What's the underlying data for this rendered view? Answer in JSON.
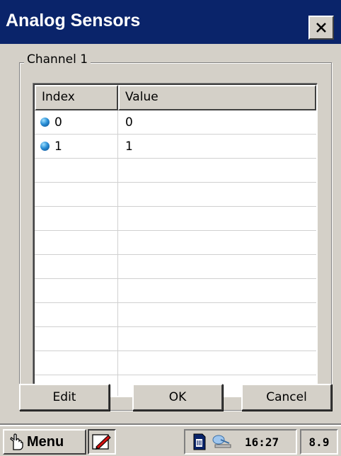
{
  "window": {
    "title": "Analog Sensors",
    "close_label": "×"
  },
  "group": {
    "label": "Channel 1"
  },
  "table": {
    "columns": [
      "Index",
      "Value"
    ],
    "rows": [
      {
        "index": "0",
        "value": "0"
      },
      {
        "index": "1",
        "value": "1"
      }
    ]
  },
  "buttons": {
    "edit": "Edit",
    "ok": "OK",
    "cancel": "Cancel"
  },
  "taskbar": {
    "menu_label": "Menu",
    "time": "16:27",
    "version": "8.9"
  },
  "icons": {
    "start": "hand-pointer-icon",
    "pen": "pen-input-icon",
    "sim": "sim-card-icon",
    "network": "network-icon",
    "row_marker": "blue-dot-icon"
  },
  "colors": {
    "titlebar": "#0a246a",
    "face": "#d4d0c8"
  }
}
